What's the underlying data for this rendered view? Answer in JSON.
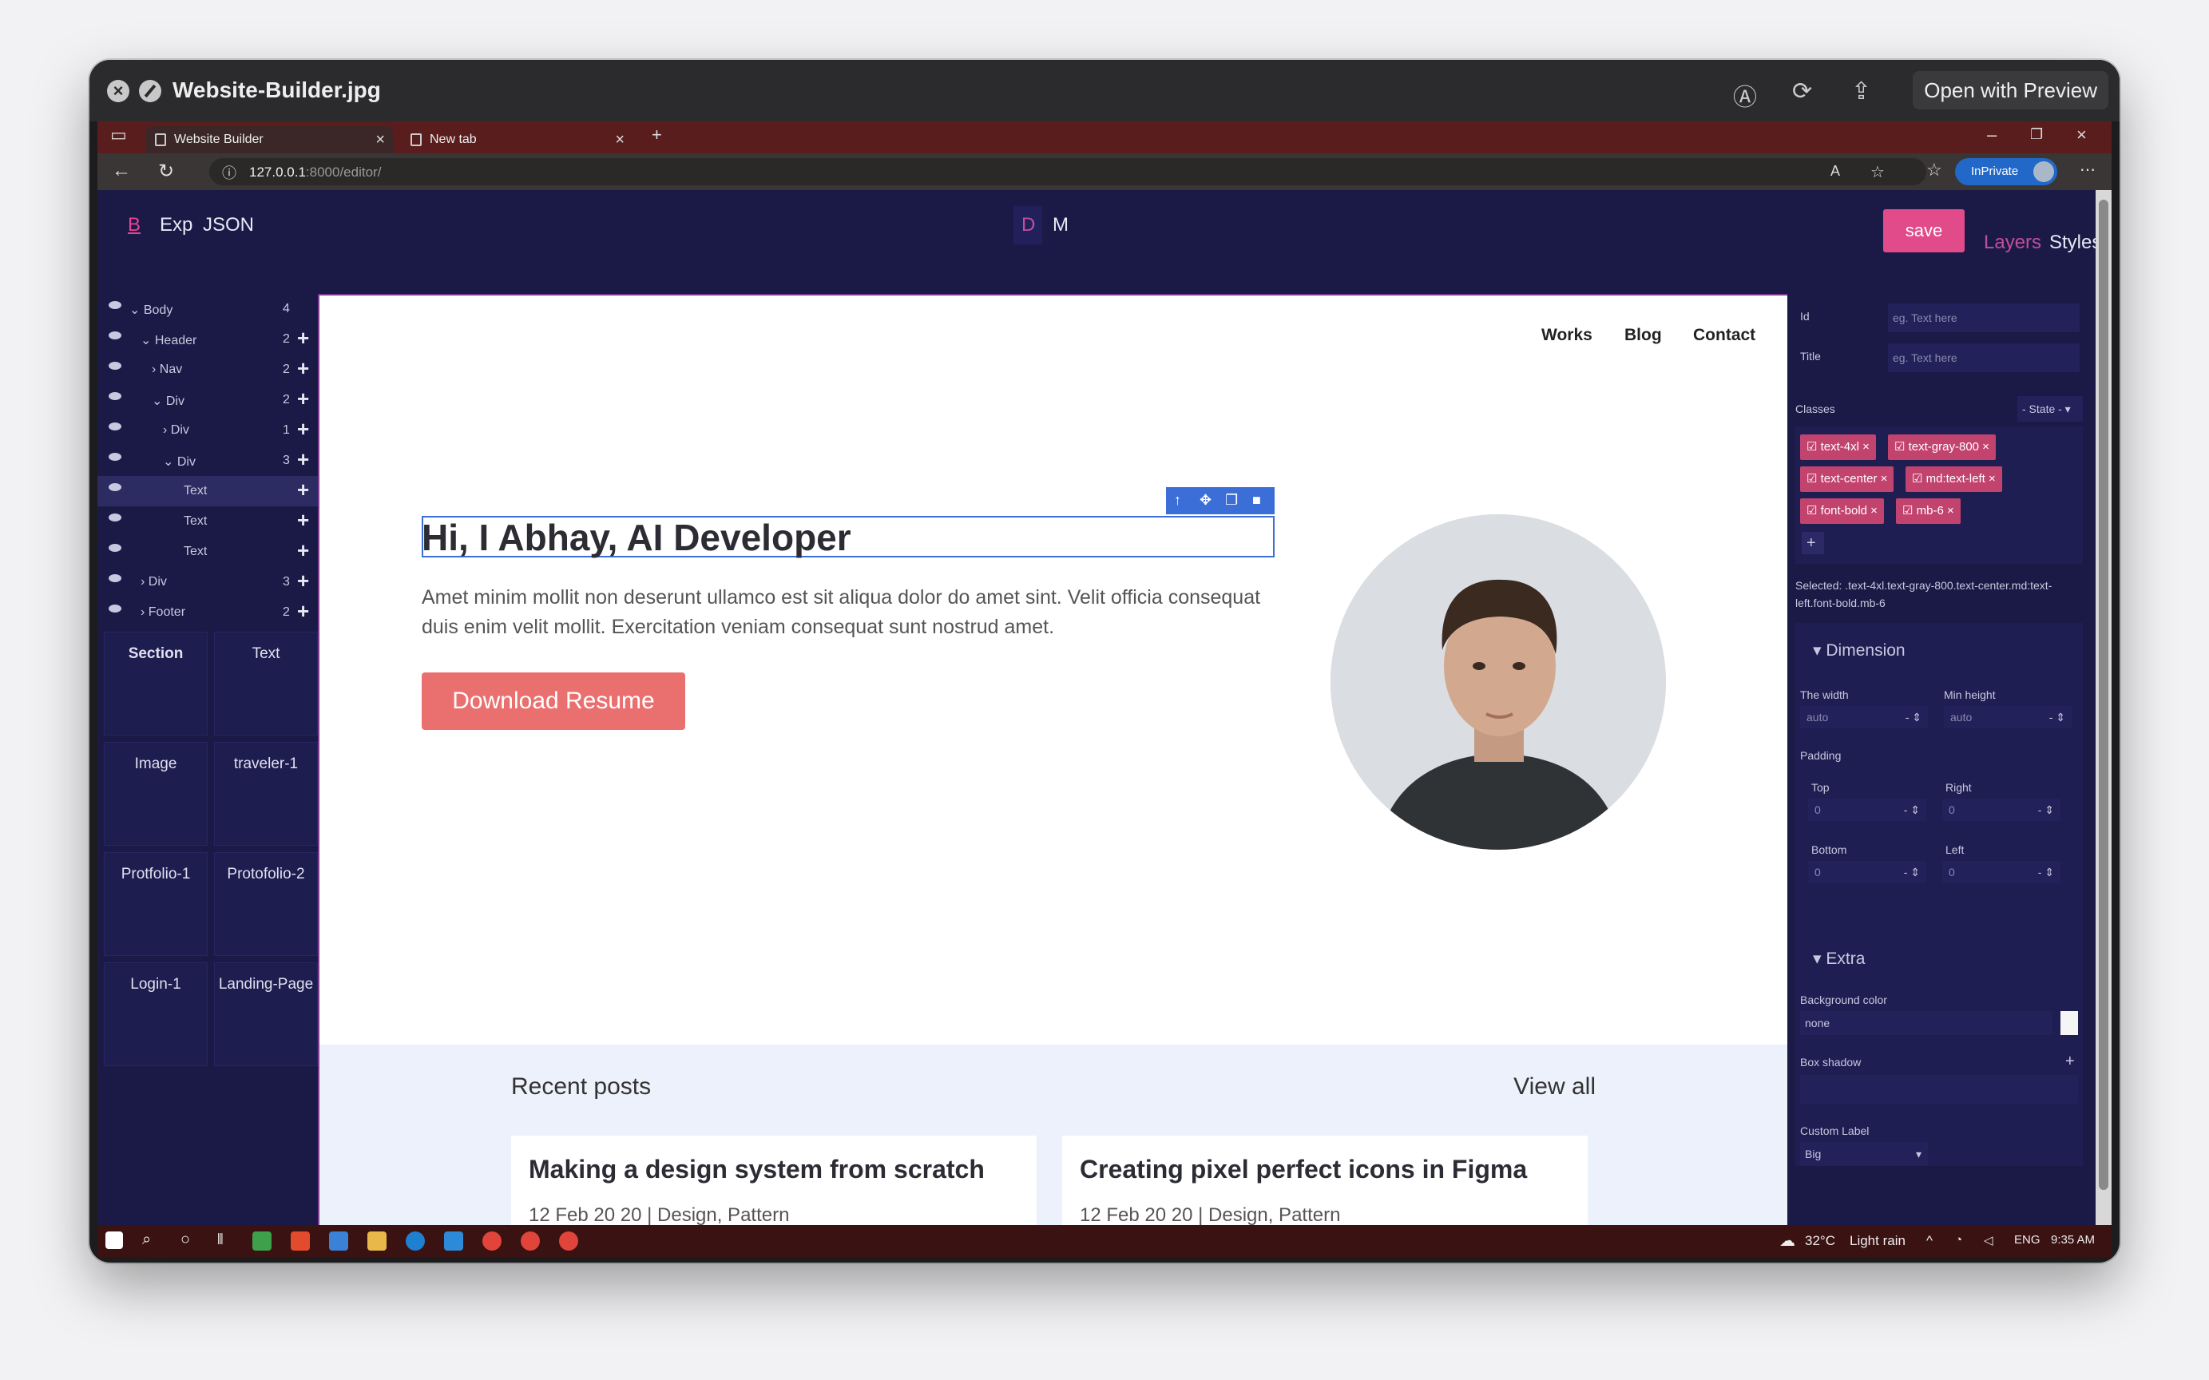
{
  "quicklook": {
    "title": "Website-Builder.jpg",
    "open_button": "Open with Preview"
  },
  "browser": {
    "tabs": [
      {
        "label": "Website Builder"
      },
      {
        "label": "New tab"
      }
    ],
    "url_host": "127.0.0.1",
    "url_rest": ":8000/editor/",
    "inprivate_label": "InPrivate"
  },
  "app": {
    "brand": "B",
    "menu": [
      "Exp",
      "JSON"
    ],
    "device_toggle": [
      "D",
      "M"
    ],
    "save_label": "save",
    "panel_tabs": [
      "Layers",
      "Styles"
    ]
  },
  "layers": [
    {
      "name": "Body",
      "count": "4",
      "expanded": true
    },
    {
      "name": "Header",
      "count": "2",
      "expanded": true
    },
    {
      "name": "Nav",
      "count": "2",
      "expanded": false
    },
    {
      "name": "Div",
      "count": "2",
      "expanded": true
    },
    {
      "name": "Div",
      "count": "1",
      "expanded": false
    },
    {
      "name": "Div",
      "count": "3",
      "expanded": true
    },
    {
      "name": "Text",
      "count": "",
      "expanded": false,
      "selected": true
    },
    {
      "name": "Text",
      "count": "",
      "expanded": false
    },
    {
      "name": "Text",
      "count": "",
      "expanded": false
    },
    {
      "name": "Div",
      "count": "3",
      "expanded": false
    },
    {
      "name": "Footer",
      "count": "2",
      "expanded": false
    }
  ],
  "blocks": [
    "Section",
    "Text",
    "Image",
    "traveler-1",
    "Protfolio-1",
    "Protofolio-2",
    "Login-1",
    "Landing-Page"
  ],
  "canvas": {
    "nav": [
      "Works",
      "Blog",
      "Contact"
    ],
    "heading": "Hi, I Abhay, AI Developer",
    "paragraph": "Amet minim mollit non deserunt ullamco est sit aliqua dolor do amet sint. Velit officia consequat duis enim velit mollit. Exercitation veniam consequat sunt nostrud amet.",
    "download_button": "Download Resume",
    "recent_posts_title": "Recent posts",
    "view_all": "View all",
    "posts": [
      {
        "title": "Making a design system from scratch",
        "meta": "12 Feb 20 20 | Design, Pattern"
      },
      {
        "title": "Creating pixel perfect icons in Figma",
        "meta": "12 Feb 20 20 | Design, Pattern"
      }
    ]
  },
  "styles_panel": {
    "id_label": "Id",
    "id_placeholder": "eg. Text here",
    "title_label": "Title",
    "title_placeholder": "eg. Text here",
    "classes_label": "Classes",
    "state_label": "- State -",
    "classes": [
      "text-4xl",
      "text-gray-800",
      "text-center",
      "md:text-left",
      "font-bold",
      "mb-6"
    ],
    "selected_text": "Selected: .text-4xl.text-gray-800.text-center.md:text-left.font-bold.mb-6",
    "dimension_title": "Dimension",
    "width_label": "The width",
    "width_value": "auto",
    "minheight_label": "Min height",
    "minheight_value": "auto",
    "padding_label": "Padding",
    "pad_top_label": "Top",
    "pad_right_label": "Right",
    "pad_bottom_label": "Bottom",
    "pad_left_label": "Left",
    "pad_value": "0",
    "extra_title": "Extra",
    "bg_label": "Background color",
    "bg_value": "none",
    "shadow_label": "Box shadow",
    "custom_label": "Custom Label",
    "custom_value": "Big"
  },
  "taskbar": {
    "weather": "32°C",
    "weather_desc": "Light rain",
    "lang": "ENG",
    "time": "9:35 AM"
  },
  "colors": {
    "app_bg": "#1b1a47",
    "accent_pink": "#e14b8a",
    "chip": "#c2436e",
    "download_button": "#ea7070",
    "tabbar": "#5a1d1d"
  }
}
